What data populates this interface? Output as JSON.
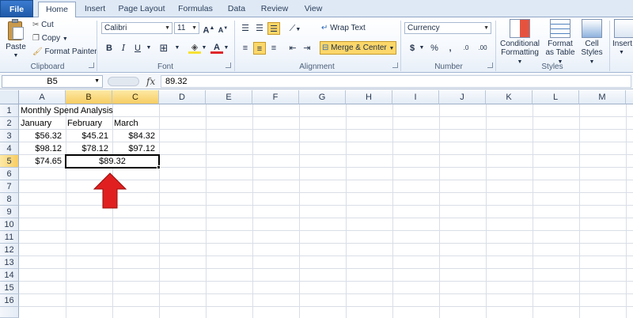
{
  "tabs": [
    "File",
    "Home",
    "Insert",
    "Page Layout",
    "Formulas",
    "Data",
    "Review",
    "View"
  ],
  "ribbon": {
    "clipboard": {
      "paste": "Paste",
      "cut": "Cut",
      "copy": "Copy",
      "format_painter": "Format Painter",
      "label": "Clipboard"
    },
    "font": {
      "name": "Calibri",
      "size": "11",
      "bold": "B",
      "italic": "I",
      "underline": "U",
      "label": "Font"
    },
    "alignment": {
      "wrap_text": "Wrap Text",
      "merge_center": "Merge & Center",
      "label": "Alignment"
    },
    "number": {
      "format": "Currency",
      "dollar": "$",
      "percent": "%",
      "comma": ",",
      "inc_decimal": ".0",
      "dec_decimal": ".00",
      "label": "Number"
    },
    "styles": {
      "conditional_1": "Conditional",
      "conditional_2": "Formatting",
      "table_1": "Format",
      "table_2": "as Table",
      "cell_1": "Cell",
      "cell_2": "Styles",
      "label": "Styles"
    },
    "insert_label": "Insert"
  },
  "formula_bar": {
    "name_box": "B5",
    "fx": "fx",
    "value": "89.32"
  },
  "columns": [
    "A",
    "B",
    "C",
    "D",
    "E",
    "F",
    "G",
    "H",
    "I",
    "J",
    "K",
    "L",
    "M"
  ],
  "rows": [
    "1",
    "2",
    "3",
    "4",
    "5",
    "6",
    "7",
    "8",
    "9",
    "10",
    "11",
    "12",
    "13",
    "14",
    "15",
    "16"
  ],
  "cells": {
    "A1": "Monthly Spend Analysis",
    "A2": "January",
    "B2": "February",
    "C2": "March",
    "A3": "$56.32",
    "B3": "$45.21",
    "C3": "$84.32",
    "A4": "$98.12",
    "B4": "$78.12",
    "C4": "$97.12",
    "A5": "$74.65",
    "B5": "$89.32"
  },
  "colors": {
    "arrow": "#e02020",
    "selection_header": "#f7cd63",
    "file_tab": "#2a67b8"
  }
}
